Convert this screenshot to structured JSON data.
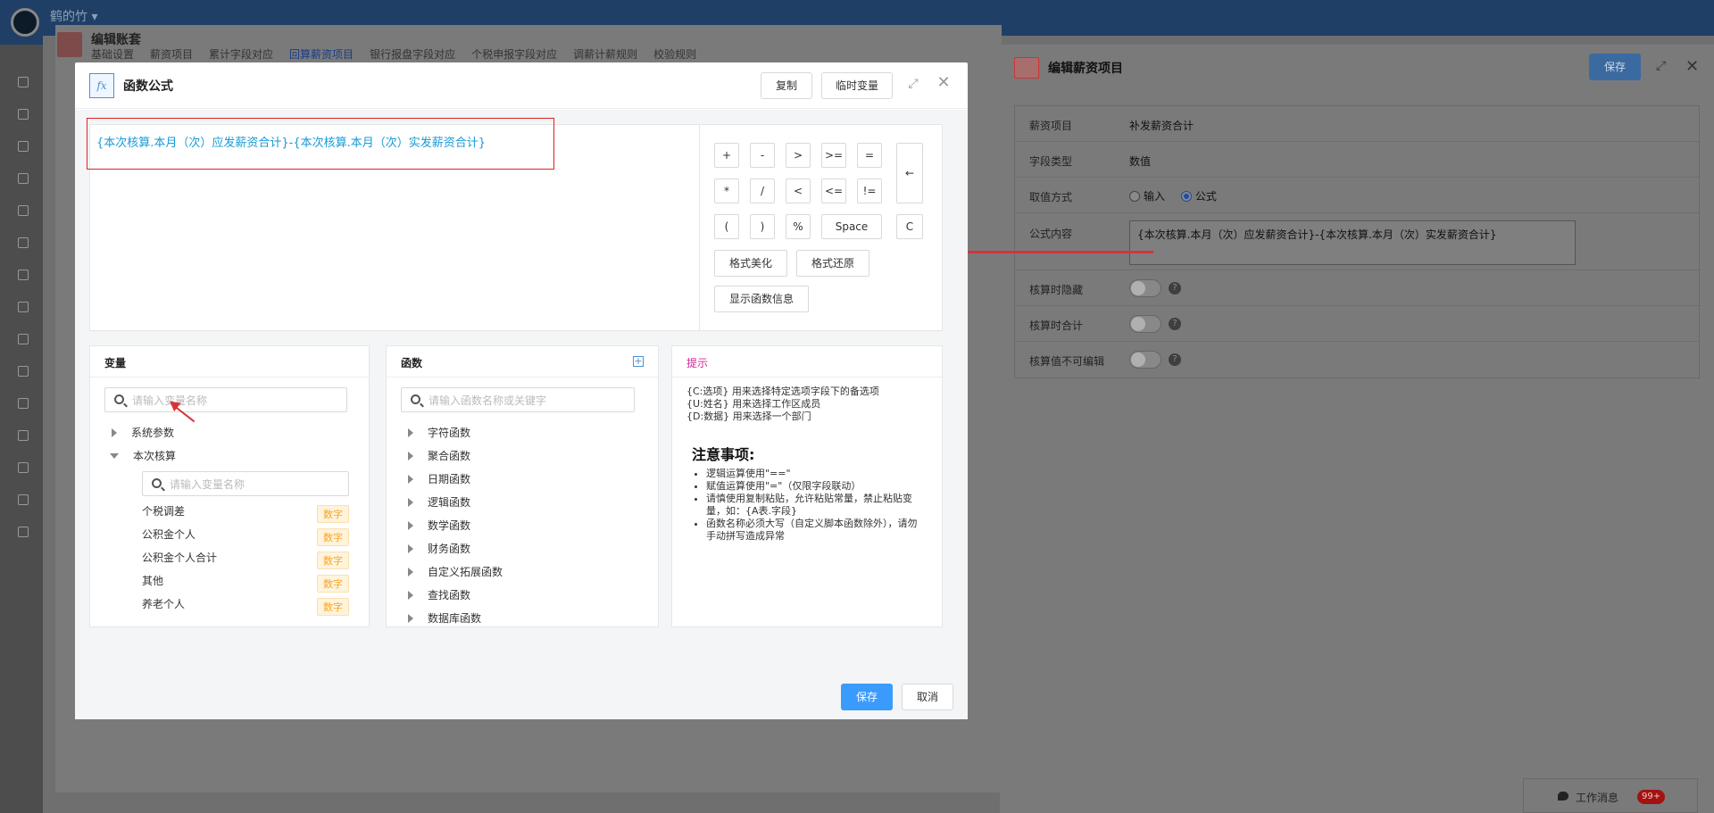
{
  "app": {
    "brand": "鹤的竹 ▾"
  },
  "bg_editor": {
    "title": "编辑账套",
    "tabs": [
      "基础设置",
      "薪资项目",
      "累计字段对应",
      "回算薪资项目",
      "银行报盘字段对应",
      "个税申报字段对应",
      "调薪计薪规则",
      "校验规则"
    ],
    "active_tab": 3
  },
  "right_panel": {
    "title": "编辑薪资项目",
    "save_label": "保存",
    "rows": [
      {
        "label": "薪资项目",
        "value": "补发薪资合计"
      },
      {
        "label": "字段类型",
        "value": "数值"
      },
      {
        "label": "取值方式",
        "opt_input": "输入",
        "opt_formula": "公式"
      },
      {
        "label": "公式内容",
        "value": "{本次核算.本月（次）应发薪资合计}-{本次核算.本月（次）实发薪资合计}"
      },
      {
        "label": "核算时隐藏"
      },
      {
        "label": "核算时合计"
      },
      {
        "label": "核算值不可编辑"
      }
    ]
  },
  "message_bar": {
    "label": "工作消息",
    "badge": "99+"
  },
  "modal": {
    "fx": "fx",
    "title": "函数公式",
    "copy_label": "复制",
    "tempvar_label": "临时变量",
    "formula": "{本次核算.本月（次）应发薪资合计}-{本次核算.本月（次）实发薪资合计}",
    "keys_row1": [
      "+",
      "-",
      ">",
      ">=",
      "="
    ],
    "keys_row2": [
      "*",
      "/",
      "<",
      "<=",
      "!="
    ],
    "keys_row3": [
      "(",
      ")",
      "%",
      "Space",
      "C"
    ],
    "key_back": "←",
    "beautify_label": "格式美化",
    "restore_label": "格式还原",
    "show_func_label": "显示函数信息",
    "variables": {
      "title": "变量",
      "search_placeholder": "请输入变量名称",
      "groups": [
        "系统参数",
        "本次核算"
      ],
      "sub_search_placeholder": "请输入变量名称",
      "items": [
        {
          "name": "个税调差",
          "tag": "数字"
        },
        {
          "name": "公积金个人",
          "tag": "数字"
        },
        {
          "name": "公积金个人合计",
          "tag": "数字"
        },
        {
          "name": "其他",
          "tag": "数字"
        },
        {
          "name": "养老个人",
          "tag": "数字"
        }
      ]
    },
    "functions": {
      "title": "函数",
      "search_placeholder": "请输入函数名称或关键字",
      "groups": [
        "字符函数",
        "聚合函数",
        "日期函数",
        "逻辑函数",
        "数学函数",
        "财务函数",
        "自定义拓展函数",
        "查找函数",
        "数据库函数"
      ]
    },
    "hint": {
      "title": "提示",
      "lines": [
        "{C:选项} 用来选择特定选项字段下的备选项",
        "{U:姓名} 用来选择工作区成员",
        "{D:数据} 用来选择一个部门"
      ],
      "heading": "注意事项:",
      "notes": [
        "逻辑运算使用\"==\"",
        "赋值运算使用\"=\"（仅限字段联动）",
        "请慎使用复制粘贴，允许粘贴常量，禁止粘贴变量，如：{A表.字段}",
        "函数名称必须大写（自定义脚本函数除外），请勿手动拼写造成异常"
      ]
    },
    "save_label": "保存",
    "cancel_label": "取消"
  },
  "colors": {
    "primary": "#3a9bfd",
    "formula": "#1a9ad6",
    "annotation": "#e02020",
    "tag": "#f5a623",
    "hint_title": "#d0279b"
  }
}
